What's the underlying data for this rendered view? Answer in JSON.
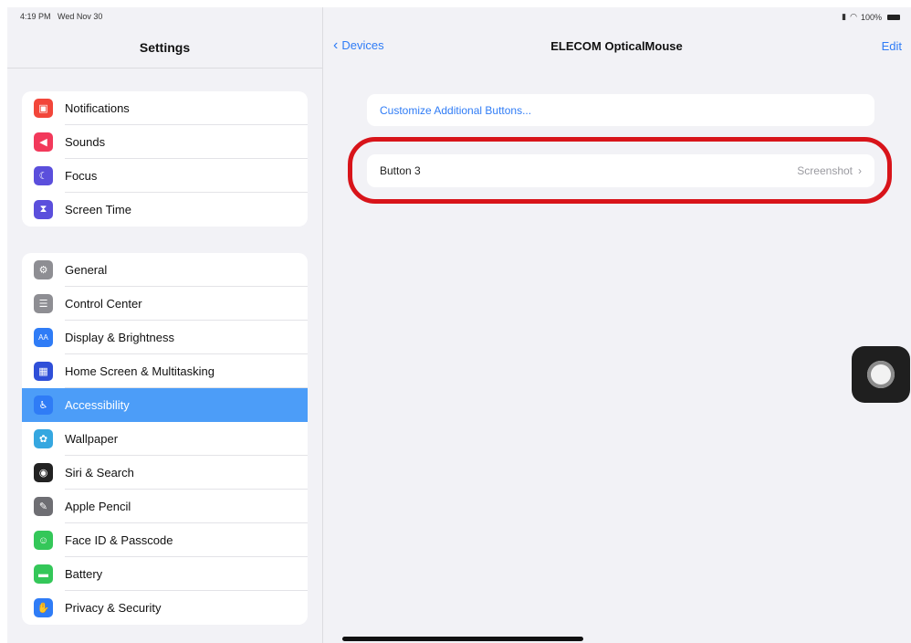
{
  "status_bar": {
    "time": "4:19 PM",
    "date": "Wed Nov 30",
    "battery": "100%"
  },
  "sidebar": {
    "title": "Settings",
    "group1": [
      {
        "label": "Notifications",
        "icon": "bell-icon",
        "color": "#f2463a",
        "glyph": "▣"
      },
      {
        "label": "Sounds",
        "icon": "speaker-icon",
        "color": "#f2395b",
        "glyph": "◀"
      },
      {
        "label": "Focus",
        "icon": "moon-icon",
        "color": "#5b4fdc",
        "glyph": "☾"
      },
      {
        "label": "Screen Time",
        "icon": "hourglass-icon",
        "color": "#5b4fdc",
        "glyph": "⧗"
      }
    ],
    "group2": [
      {
        "label": "General",
        "icon": "gear-icon",
        "color": "#8e8e93",
        "glyph": "⚙"
      },
      {
        "label": "Control Center",
        "icon": "toggles-icon",
        "color": "#8e8e93",
        "glyph": "☰"
      },
      {
        "label": "Display & Brightness",
        "icon": "text-size-icon",
        "color": "#2f7cf6",
        "glyph": "AA"
      },
      {
        "label": "Home Screen & Multitasking",
        "icon": "grid-icon",
        "color": "#2f4fd8",
        "glyph": "▦"
      },
      {
        "label": "Accessibility",
        "icon": "accessibility-icon",
        "color": "#2f7cf6",
        "glyph": "♿",
        "selected": true
      },
      {
        "label": "Wallpaper",
        "icon": "flower-icon",
        "color": "#35a7e0",
        "glyph": "✿"
      },
      {
        "label": "Siri & Search",
        "icon": "siri-icon",
        "color": "#222",
        "glyph": "◉"
      },
      {
        "label": "Apple Pencil",
        "icon": "pencil-icon",
        "color": "#6e6e73",
        "glyph": "✎"
      },
      {
        "label": "Face ID & Passcode",
        "icon": "face-id-icon",
        "color": "#34c759",
        "glyph": "☺"
      },
      {
        "label": "Battery",
        "icon": "battery-icon",
        "color": "#34c759",
        "glyph": "▬"
      },
      {
        "label": "Privacy & Security",
        "icon": "hand-icon",
        "color": "#2f7cf6",
        "glyph": "✋"
      }
    ]
  },
  "detail": {
    "back_label": "Devices",
    "title": "ELECOM OpticalMouse",
    "edit_label": "Edit",
    "customize_label": "Customize Additional Buttons...",
    "button_row": {
      "label": "Button 3",
      "value": "Screenshot"
    }
  }
}
